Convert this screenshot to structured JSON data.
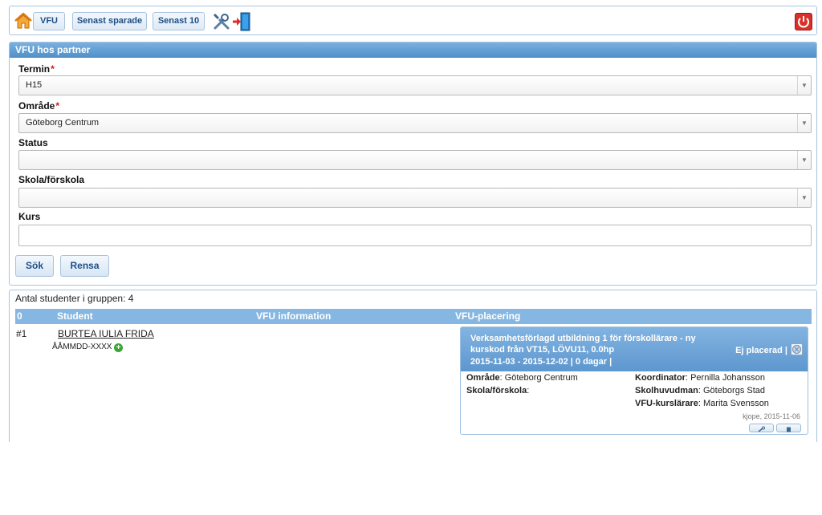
{
  "toolbar": {
    "home_icon": "home-icon",
    "buttons": [
      {
        "label": "VFU"
      },
      {
        "label": "Senast sparade"
      },
      {
        "label": "Senast 10"
      }
    ],
    "tools_icon": "tools-icon",
    "exit_icon": "exit-door-icon",
    "power_icon": "power-icon"
  },
  "search_panel": {
    "title": "VFU hos partner",
    "termin": {
      "label": "Termin",
      "required_mark": "*",
      "value": "H15"
    },
    "omrade": {
      "label": "Område",
      "required_mark": "*",
      "value": "Göteborg Centrum"
    },
    "status": {
      "label": "Status",
      "value": ""
    },
    "skola": {
      "label": "Skola/förskola",
      "value": ""
    },
    "kurs": {
      "label": "Kurs",
      "value": ""
    },
    "search_button": "Sök",
    "clear_button": "Rensa"
  },
  "results": {
    "count_text": "Antal studenter i gruppen: 4",
    "columns": [
      "0",
      "Student",
      "VFU information",
      "VFU-placering"
    ],
    "rows": [
      {
        "num": "#1",
        "student_name": "BURTEA IULIA FRIDA",
        "personnummer": "ÅÅMMDD-XXXX",
        "placement": {
          "title": "Verksamhetsförlagd utbildning 1 för förskollärare - ny kurskod från VT15, LÖVU11, 0.0hp",
          "dates": "2015-11-03 - 2015-12-02 | 0 dagar |",
          "status": "Ej placerad |",
          "omrade_label": "Område",
          "omrade_value": "Göteborg Centrum",
          "skola_label": "Skola/förskola",
          "skola_value": "",
          "koordinator_label": "Koordinator",
          "koordinator_value": "Pernilla Johansson",
          "skolhuvudman_label": "Skolhuvudman",
          "skolhuvudman_value": "Göteborgs Stad",
          "kurslarare_label": "VFU-kurslärare",
          "kurslarare_value": "Marita Svensson",
          "meta": "kjope, 2015-11-06"
        }
      }
    ]
  },
  "colors": {
    "accent": "#4f8fc9",
    "header_blue": "#86b7e2",
    "danger": "#d9302a",
    "success": "#3aa535"
  }
}
